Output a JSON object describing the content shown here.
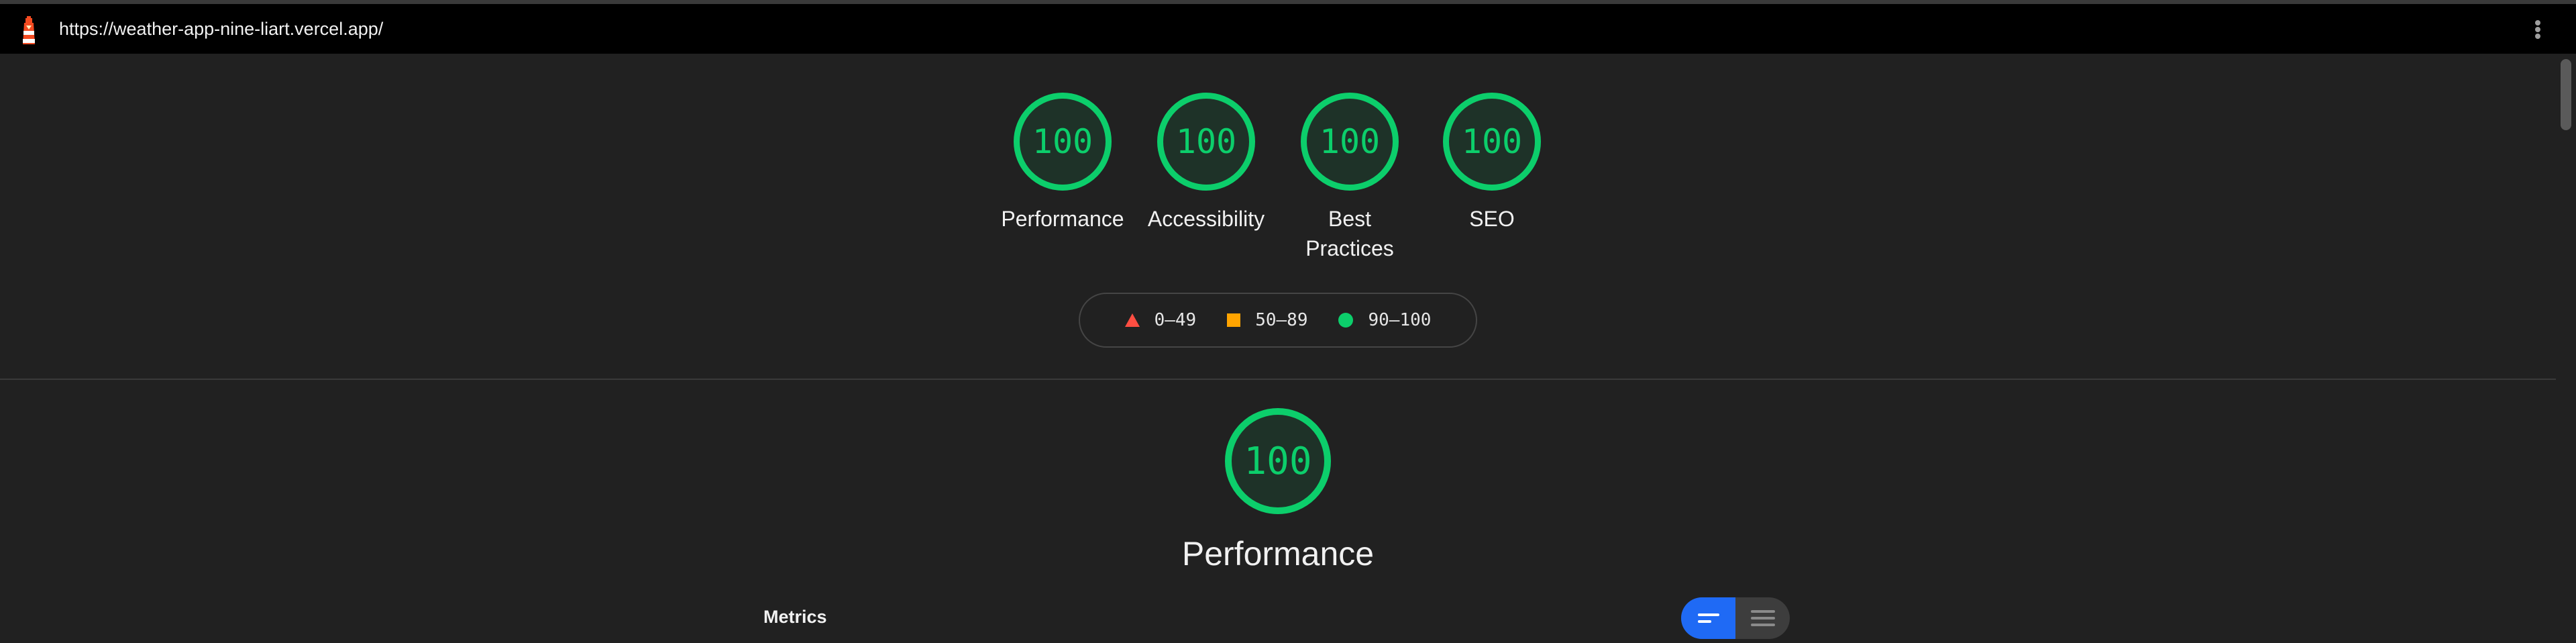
{
  "browser": {
    "url": "https://weather-app-nine-liart.vercel.app/",
    "logo_icon": "lighthouse-icon",
    "menu_icon": "kebab-menu-icon"
  },
  "scores": [
    {
      "label": "Performance",
      "value": "100"
    },
    {
      "label": "Accessibility",
      "value": "100"
    },
    {
      "label": "Best Practices",
      "value": "100"
    },
    {
      "label": "SEO",
      "value": "100"
    }
  ],
  "legend": {
    "fail": "0–49",
    "average": "50–89",
    "pass": "90–100"
  },
  "performance": {
    "score": "100",
    "title": "Performance",
    "metrics_label": "Metrics"
  },
  "colors": {
    "pass": "#0cce6b",
    "average": "#ffa400",
    "fail": "#ff4e42",
    "toggle_active": "#1f6af5"
  }
}
